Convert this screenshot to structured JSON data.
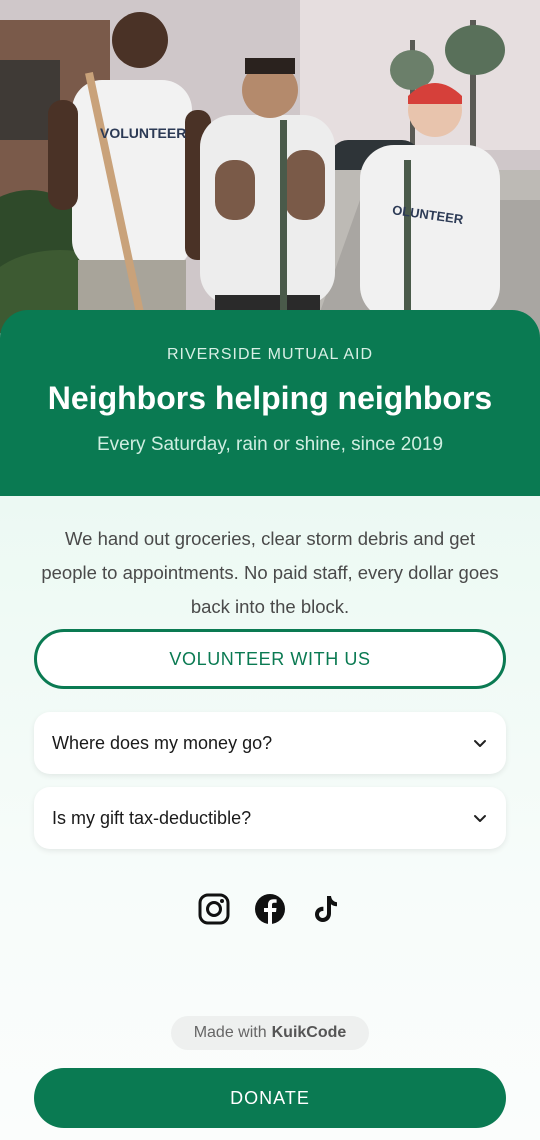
{
  "hero": {
    "shirt_text": "VOLUNTEER"
  },
  "header": {
    "org_name": "RIVERSIDE MUTUAL AID",
    "headline": "Neighbors helping neighbors",
    "tagline": "Every Saturday, rain or shine, since 2019"
  },
  "main": {
    "description": "We hand out groceries, clear storm debris and get people to appointments. No paid staff, every dollar goes back into the block.",
    "volunteer_label": "VOLUNTEER WITH US",
    "faqs": [
      {
        "question": "Where does my money go?",
        "icon": "chevron-down-icon"
      },
      {
        "question": "Is my gift tax-deductible?",
        "icon": "chevron-down-icon"
      }
    ],
    "socials": [
      "instagram-icon",
      "facebook-icon",
      "tiktok-icon"
    ]
  },
  "footer": {
    "made_with_prefix": "Made with",
    "made_with_brand": "KuikCode",
    "donate_label": "DONATE"
  },
  "colors": {
    "brand_green": "#0a7a52",
    "background": "#f4fbf8"
  }
}
